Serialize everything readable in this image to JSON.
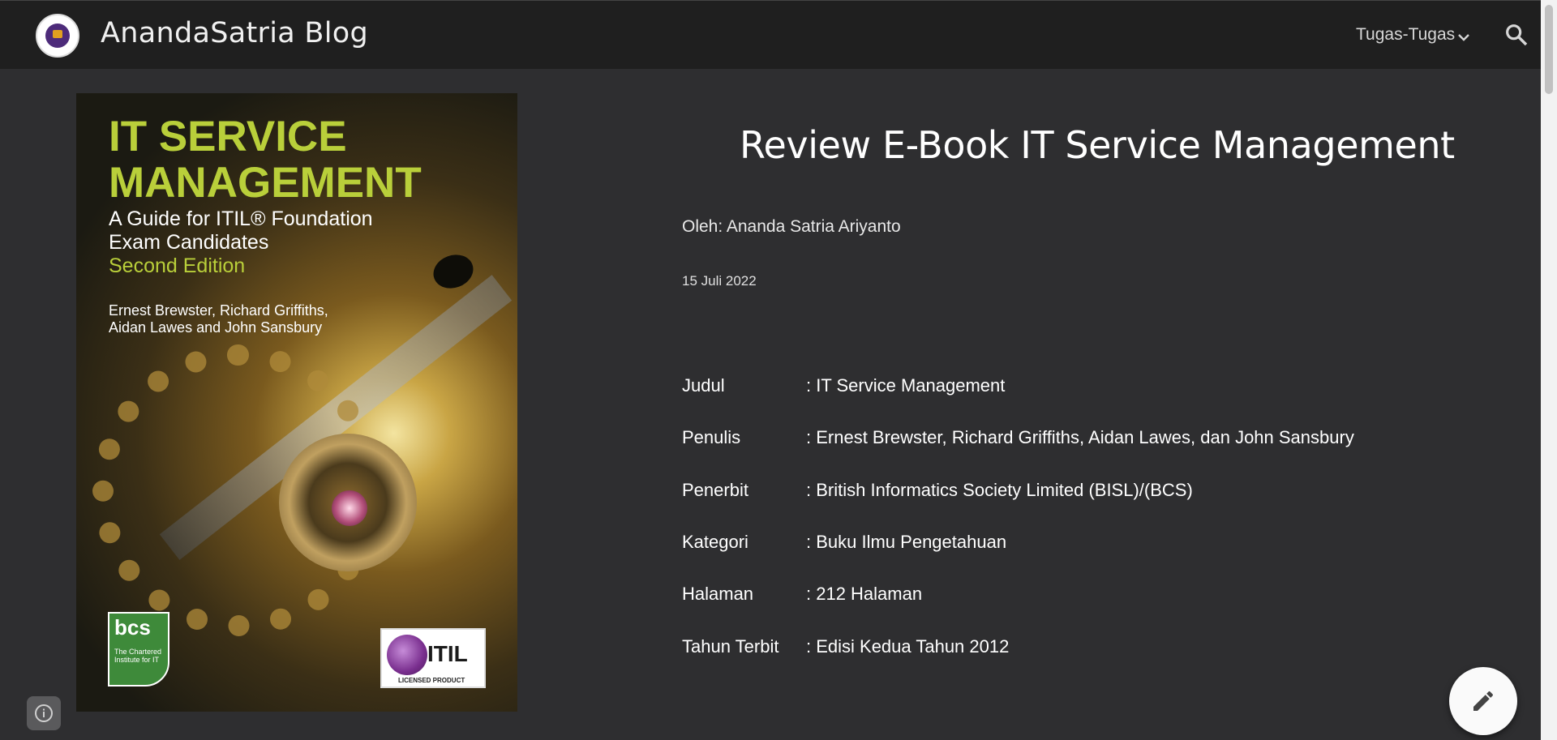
{
  "header": {
    "site_title": "AnandaSatria Blog",
    "nav_label": "Tugas-Tugas",
    "logo_icon": "university-logo-icon"
  },
  "cover": {
    "title": "IT SERVICE MANAGEMENT",
    "subtitle_line1": "A Guide for ITIL® Foundation",
    "subtitle_line2": "Exam Candidates",
    "edition": "Second Edition",
    "authors_line1": "Ernest Brewster, Richard Griffiths,",
    "authors_line2": "Aidan Lawes and John Sansbury",
    "bcs_logo": "bcs",
    "bcs_text": "The Chartered Institute for IT",
    "itil_logo": "ITIL",
    "itil_text": "LICENSED PRODUCT"
  },
  "post": {
    "title": "Review E-Book IT Service Management",
    "author": "Oleh: Ananda Satria Ariyanto",
    "date": "15 Juli 2022",
    "meta": [
      {
        "key": "Judul",
        "value": ": IT Service Management"
      },
      {
        "key": "Penulis",
        "value": ": Ernest Brewster, Richard Griffiths, Aidan Lawes, dan John Sansbury"
      },
      {
        "key": "Penerbit",
        "value": ": British Informatics Society Limited (BISL)/(BCS)"
      },
      {
        "key": "Kategori",
        "value": ": Buku Ilmu Pengetahuan"
      },
      {
        "key": "Halaman",
        "value": ": 212 Halaman"
      },
      {
        "key": "Tahun Terbit",
        "value": ": Edisi Kedua Tahun 2012"
      }
    ]
  },
  "colors": {
    "header_bg": "#1f1f1f",
    "page_bg": "#2e2e30",
    "cover_accent": "#b9cf3a"
  }
}
